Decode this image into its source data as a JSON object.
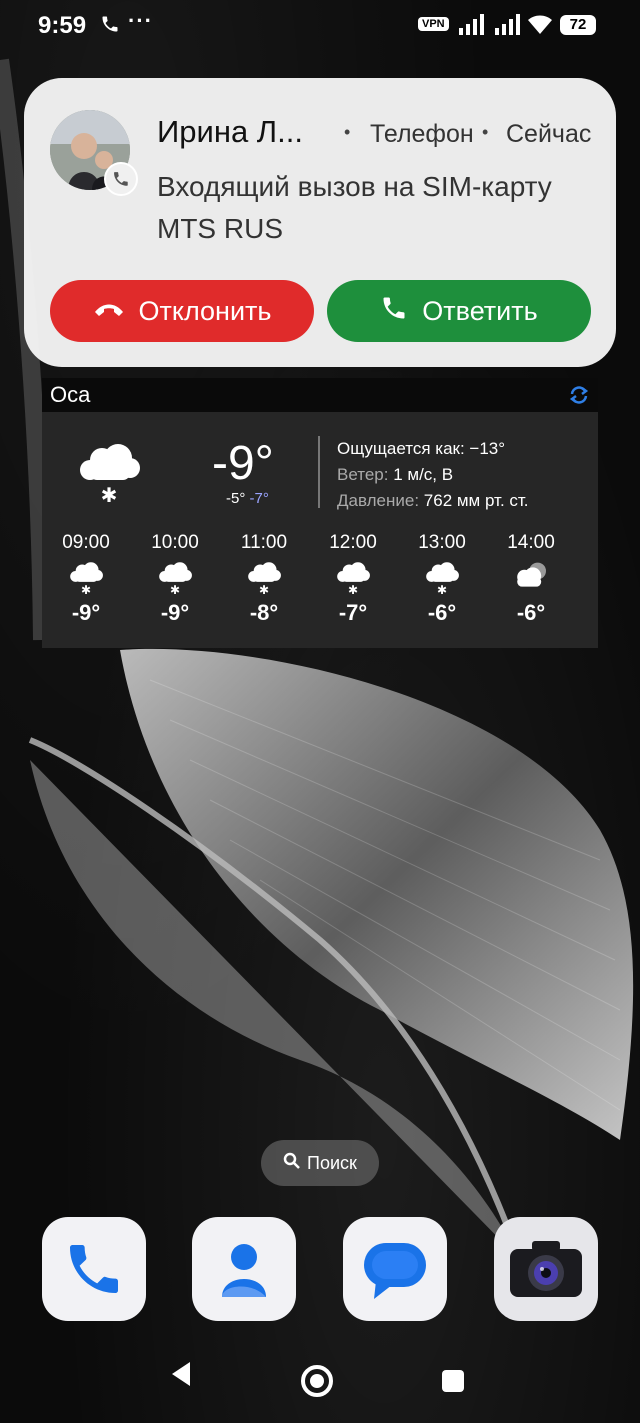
{
  "status_bar": {
    "time": "9:59",
    "vpn": "VPN",
    "battery": "72",
    "icons": [
      "phone-call-icon",
      "more-dots-icon",
      "signal-icon",
      "signal-icon",
      "wifi-icon",
      "battery-icon"
    ]
  },
  "notification": {
    "caller_name": "Ирина Л...",
    "separator": "•",
    "app": "Телефон",
    "time": "Сейчас",
    "message": "Входящий вызов на SIM-карту MTS RUS",
    "decline_label": "Отклонить",
    "answer_label": "Ответить",
    "colors": {
      "decline": "#e02b2b",
      "answer": "#1e8f3c"
    }
  },
  "weather": {
    "city": "Оса",
    "current_temp": "-9°",
    "temp_high": "-5°",
    "temp_low": "-7°",
    "feels_like_label": "Ощущается как:",
    "feels_like_value": "−13°",
    "wind_label": "Ветер:",
    "wind_value": "1 м/с, В",
    "pressure_label": "Давление:",
    "pressure_value": "762 мм рт. ст.",
    "current_icon": "snow-cloud-icon",
    "hourly": [
      {
        "time": "09:00",
        "temp": "-9°",
        "icon": "snow-cloud-icon"
      },
      {
        "time": "10:00",
        "temp": "-9°",
        "icon": "snow-cloud-icon"
      },
      {
        "time": "11:00",
        "temp": "-8°",
        "icon": "snow-cloud-icon"
      },
      {
        "time": "12:00",
        "temp": "-7°",
        "icon": "snow-cloud-icon"
      },
      {
        "time": "13:00",
        "temp": "-6°",
        "icon": "snow-cloud-icon"
      },
      {
        "time": "14:00",
        "temp": "-6°",
        "icon": "cloudy-icon"
      }
    ]
  },
  "search": {
    "label": "Поиск"
  },
  "dock": [
    "phone-app-icon",
    "contacts-app-icon",
    "messages-app-icon",
    "camera-app-icon"
  ],
  "nav": [
    "back-icon",
    "home-icon",
    "recents-icon"
  ]
}
